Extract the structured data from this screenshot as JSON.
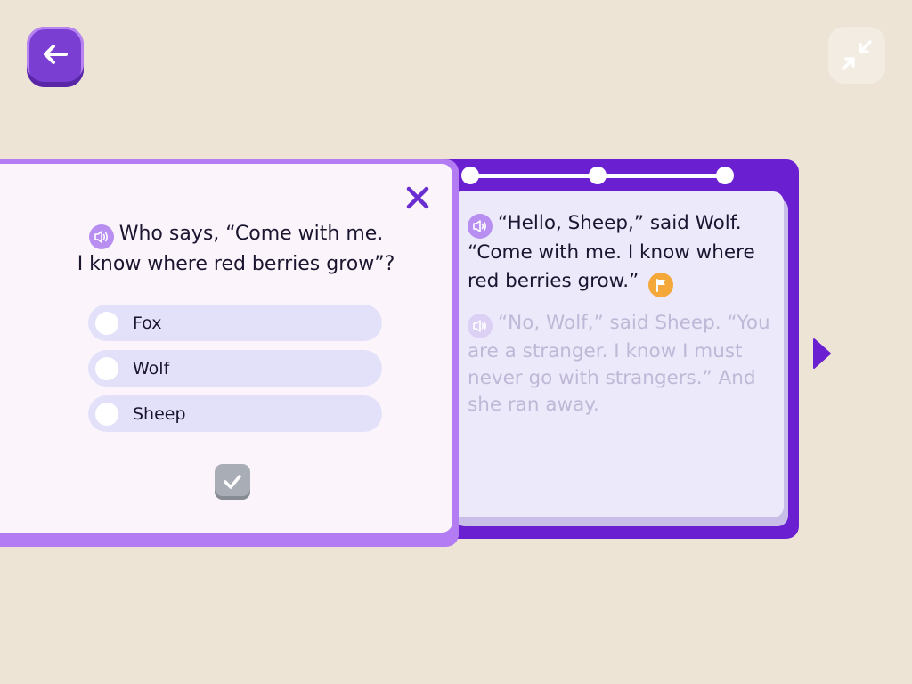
{
  "icons": {
    "back": "arrow-left-icon",
    "shrink": "shrink-icon",
    "speaker": "speaker-icon",
    "flag": "flag-icon",
    "close": "close-icon",
    "next": "chevron-right-icon",
    "check": "check-icon"
  },
  "colors": {
    "background": "#ede4d6",
    "accent": "#6a1fd0",
    "accent_light": "#b47cf2",
    "flag": "#f4a83a"
  },
  "story": {
    "paragraph_1": "“Hello, Sheep,” said Wolf. “Come with me. I know where red berries grow.”",
    "paragraph_2": "“No, Wolf,” said Sheep. “You are a stranger. I know I must never go with strangers.” And she ran away."
  },
  "quiz": {
    "question_line_1": "Who says, “Come with me.",
    "question_line_2": "I know where red berries grow”?",
    "options": [
      {
        "label": "Fox"
      },
      {
        "label": "Wolf"
      },
      {
        "label": "Sheep"
      }
    ]
  }
}
